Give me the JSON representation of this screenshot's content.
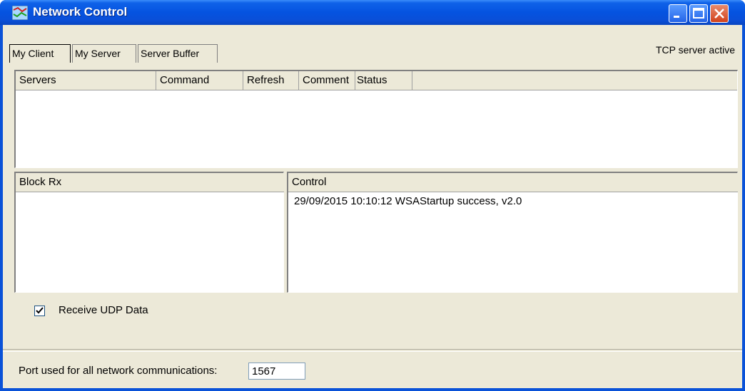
{
  "window": {
    "title": "Network Control"
  },
  "tabs": [
    {
      "label": "My Client"
    },
    {
      "label": "My Server"
    },
    {
      "label": "Server Buffer"
    }
  ],
  "status": {
    "tcp": "TCP server active"
  },
  "servers_table": {
    "columns": [
      "Servers",
      "Command",
      "Refresh",
      "Comment",
      "Status"
    ]
  },
  "block_rx": {
    "header": "Block Rx"
  },
  "control": {
    "header": "Control",
    "log": [
      "29/09/2015 10:10:12  WSAStartup success, v2.0"
    ]
  },
  "options": {
    "receive_udp_label": "Receive UDP Data",
    "receive_udp_checked": true
  },
  "port": {
    "label": "Port used for all network communications:",
    "value": "1567"
  },
  "colors": {
    "titlebar": "#0553e0",
    "face": "#ece9d8",
    "close_button": "#d2421c"
  }
}
